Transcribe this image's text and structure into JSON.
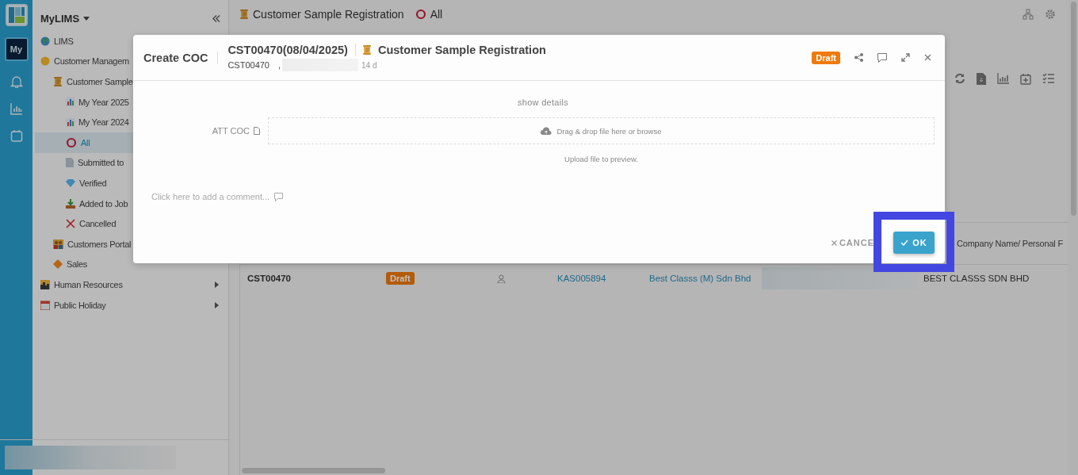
{
  "rail": {
    "badge": "My"
  },
  "sidebar": {
    "title": "MyLIMS",
    "items": [
      {
        "label": "LIMS",
        "selected": false
      },
      {
        "label": "Customer Managem",
        "selected": false,
        "expanded": true,
        "children": [
          {
            "label": "Customer Sample",
            "selected": false,
            "expanded": true,
            "children": [
              {
                "label": "My Year 2025",
                "selected": false
              },
              {
                "label": "My Year 2024",
                "selected": false
              },
              {
                "label": "All",
                "selected": true
              },
              {
                "label": "Submitted to",
                "selected": false
              },
              {
                "label": "Verified",
                "selected": false
              },
              {
                "label": "Added to Job",
                "selected": false
              },
              {
                "label": "Cancelled",
                "selected": false
              }
            ]
          },
          {
            "label": "Customers Portal",
            "selected": false
          },
          {
            "label": "Sales",
            "selected": false
          }
        ]
      },
      {
        "label": "Human Resources",
        "selected": false,
        "expanded": false
      },
      {
        "label": "Public Holiday",
        "selected": false,
        "expanded": false
      }
    ]
  },
  "breadcrumb": {
    "module": "Customer Sample Registration",
    "view": "All"
  },
  "table": {
    "columns": [
      {
        "label": "Company Name/ Personal F"
      }
    ],
    "rows": [
      {
        "id": "CST00470",
        "status": "Draft",
        "reference": "KAS005894",
        "customer": "Best Classs (M) Sdn Bhd",
        "company_name": "BEST CLASSS SDN BHD"
      }
    ]
  },
  "dialog": {
    "title": "Create COC",
    "record": "CST00470(08/04/2025)",
    "module": "Customer Sample Registration",
    "code": "CST00470",
    "separator": ",",
    "age": "14 d",
    "status": "Draft",
    "show_details": "show details",
    "attachment_label": "ATT COC",
    "dropzone": "Drag & drop file here or browse",
    "preview_hint": "Upload file to preview.",
    "comment_placeholder": "Click here to add a comment...",
    "cancel": "CANCE",
    "ok": "OK"
  }
}
